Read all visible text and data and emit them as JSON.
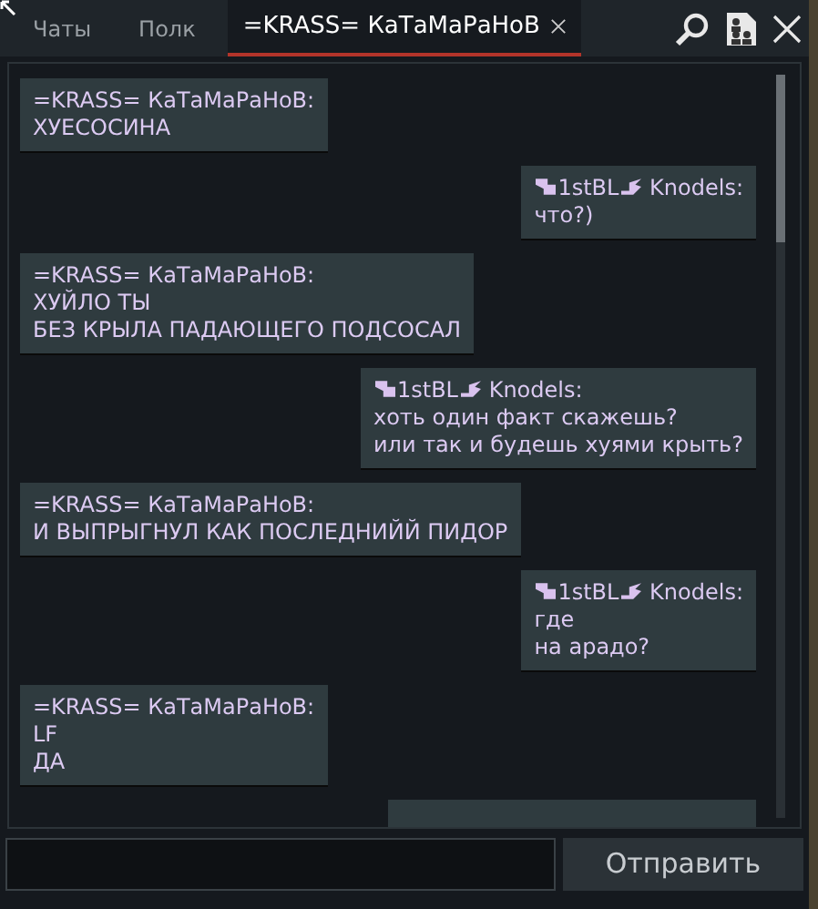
{
  "tabs": [
    {
      "label": "Чаты",
      "selected": false
    },
    {
      "label": "Полк",
      "selected": false
    },
    {
      "label": "=KRASS= КаТаМаРаНоВ",
      "selected": true
    }
  ],
  "messages": [
    {
      "kind": "incoming",
      "sender": "=KRASS= КаТаМаРаНоВ:",
      "lines": [
        "ХУЕСОСИНА"
      ]
    },
    {
      "kind": "outgoing",
      "clan": "1stBL",
      "sender": "Knodels:",
      "lines": [
        "что?)"
      ]
    },
    {
      "kind": "incoming",
      "sender": "=KRASS= КаТаМаРаНоВ:",
      "lines": [
        "ХУЙЛО ТЫ",
        "БЕЗ КРЫЛА ПАДАЮЩЕГО ПОДСОСАЛ"
      ]
    },
    {
      "kind": "outgoing",
      "clan": "1stBL",
      "sender": "Knodels:",
      "lines": [
        "хоть один факт скажешь?",
        "или так и будешь хуями крыть?"
      ]
    },
    {
      "kind": "incoming",
      "sender": "=KRASS= КаТаМаРаНоВ:",
      "lines": [
        "И ВЫПРЫГНУЛ КАК ПОСЛЕДНИЙЙ ПИДОР"
      ]
    },
    {
      "kind": "outgoing",
      "clan": "1stBL",
      "sender": "Knodels:",
      "lines": [
        "где",
        "на арадо?"
      ]
    },
    {
      "kind": "incoming",
      "sender": "=KRASS= КаТаМаРаНоВ:",
      "lines": [
        "LF",
        "ДА"
      ]
    },
    {
      "kind": "cut"
    }
  ],
  "send_button": "Отправить"
}
